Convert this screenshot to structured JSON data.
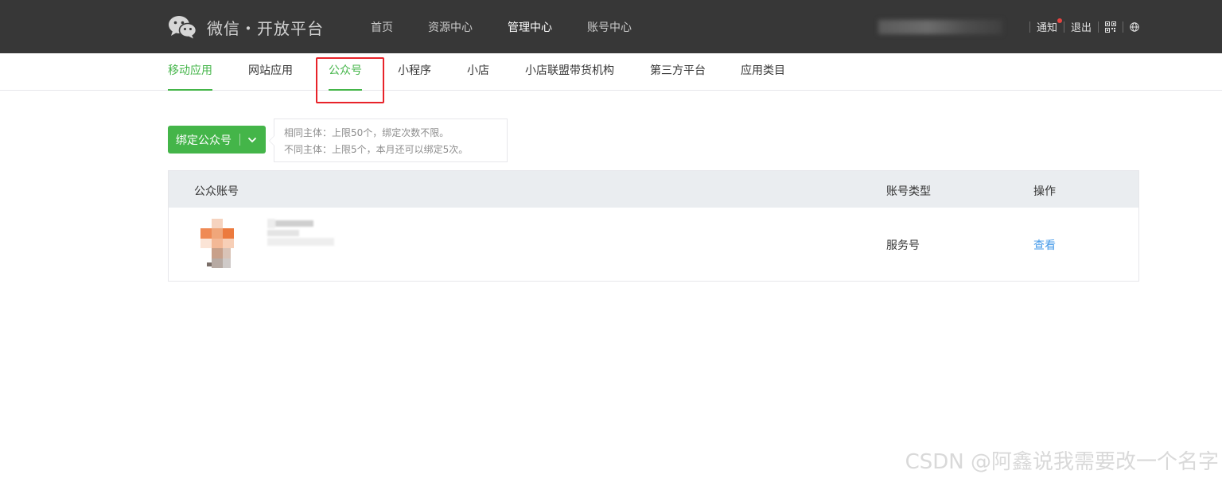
{
  "header": {
    "logo_text": "微信・开放平台",
    "nav": [
      {
        "label": "首页",
        "active": false
      },
      {
        "label": "资源中心",
        "active": false
      },
      {
        "label": "管理中心",
        "active": true
      },
      {
        "label": "账号中心",
        "active": false
      }
    ],
    "notify_label": "通知",
    "logout_label": "退出"
  },
  "subnav": {
    "items": [
      {
        "label": "移动应用"
      },
      {
        "label": "网站应用"
      },
      {
        "label": "公众号"
      },
      {
        "label": "小程序"
      },
      {
        "label": "小店"
      },
      {
        "label": "小店联盟带货机构"
      },
      {
        "label": "第三方平台"
      },
      {
        "label": "应用类目"
      }
    ],
    "active_item": "移动应用"
  },
  "bind_button": {
    "label": "绑定公众号"
  },
  "tip": {
    "line1": "相同主体：上限50个，绑定次数不限。",
    "line2": "不同主体：上限5个，本月还可以绑定5次。"
  },
  "table": {
    "headers": {
      "account": "公众账号",
      "type": "账号类型",
      "action": "操作"
    },
    "rows": [
      {
        "type": "服务号",
        "action": "查看"
      }
    ]
  },
  "watermark": "CSDN @阿鑫说我需要改一个名字",
  "colors": {
    "topbar": "#373737",
    "accent_green": "#44b549",
    "link_blue": "#459ae9",
    "highlight_red": "#e8232a",
    "notify_dot": "#e64340"
  },
  "icons": {
    "logo": "wechat-logo-icon",
    "chevron": "chevron-down-icon",
    "qrcode": "qrcode-icon",
    "globe": "globe-icon"
  }
}
